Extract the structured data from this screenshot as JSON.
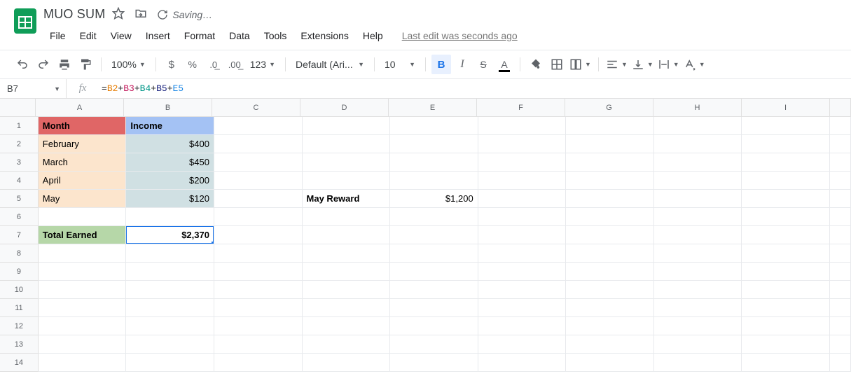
{
  "app": {
    "title": "MUO SUM",
    "saving_status": "Saving…",
    "last_edit": "Last edit was seconds ago"
  },
  "menu": {
    "file": "File",
    "edit": "Edit",
    "view": "View",
    "insert": "Insert",
    "format": "Format",
    "data": "Data",
    "tools": "Tools",
    "extensions": "Extensions",
    "help": "Help"
  },
  "toolbar": {
    "zoom": "100%",
    "format_num": "123",
    "font": "Default (Ari...",
    "font_size": "10"
  },
  "formula_bar": {
    "cell_ref": "B7",
    "formula_tokens": {
      "t1": "B2",
      "t2": "B3",
      "t3": "B4",
      "t4": "B5",
      "t5": "E5"
    }
  },
  "columns": [
    "A",
    "B",
    "C",
    "D",
    "E",
    "F",
    "G",
    "H",
    "I",
    ""
  ],
  "rows": [
    "1",
    "2",
    "3",
    "4",
    "5",
    "6",
    "7",
    "8",
    "9",
    "10",
    "11",
    "12",
    "13",
    "14"
  ],
  "cells": {
    "A1": "Month",
    "B1": "Income",
    "A2": "February",
    "B2": "$400",
    "A3": "March",
    "B3": "$450",
    "A4": "April",
    "B4": "$200",
    "A5": "May",
    "B5": "$120",
    "D5": "May Reward",
    "E5": "$1,200",
    "A7": "Total Earned",
    "B7": "$2,370"
  }
}
